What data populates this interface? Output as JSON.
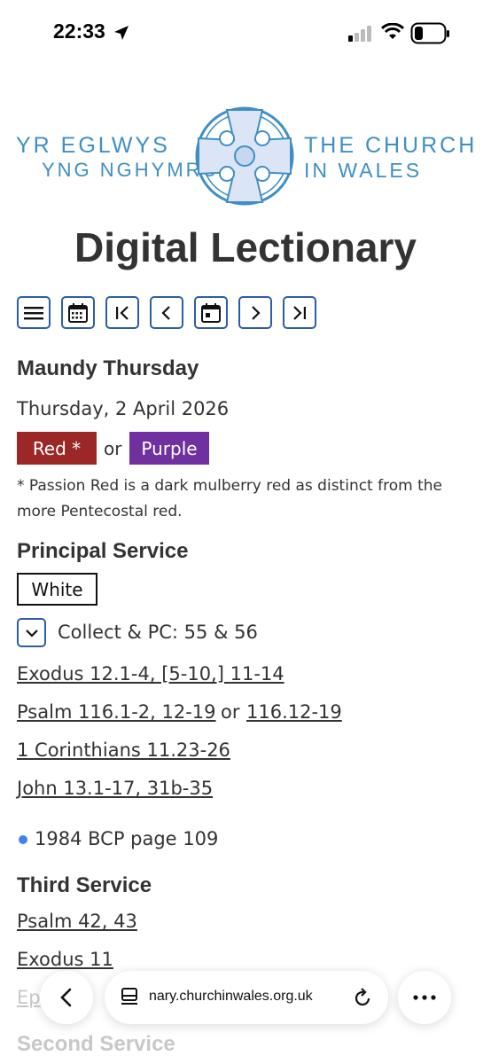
{
  "status": {
    "time": "22:33"
  },
  "logo": {
    "left_line1": "YR EGLWYS",
    "left_line2": "YNG NGHYMRU",
    "right_line1": "THE CHURCH",
    "right_line2": "IN WALES"
  },
  "page_title": "Digital Lectionary",
  "toolbar": [
    "menu-icon",
    "calendar-grid-icon",
    "first-icon",
    "prev-icon",
    "calendar-today-icon",
    "next-icon",
    "last-icon"
  ],
  "day": {
    "name": "Maundy Thursday",
    "date": "Thursday, 2 April 2026",
    "colour1": "Red *",
    "or": "or",
    "colour2": "Purple",
    "note": "* Passion Red is a dark mulberry red as distinct from the more Pentecostal red."
  },
  "principal": {
    "heading": "Principal Service",
    "colour": "White",
    "collect": "Collect & PC: 55 & 56",
    "readings": {
      "r1": "Exodus 12.1-4, [5-10,] 11-14",
      "psalm_a": "Psalm 116.1-2, 12-19",
      "psalm_or": "or",
      "psalm_b": "116.12-19",
      "r2": "1 Corinthians 11.23-26",
      "gospel": "John 13.1-17, 31b-35"
    },
    "bcp": "1984 BCP page 109"
  },
  "third": {
    "heading": "Third Service",
    "r1": "Psalm 42, 43",
    "r2": "Exodus 11",
    "r3": "Ep"
  },
  "second": {
    "heading": "Second Service"
  },
  "browser": {
    "url": "nary.churchinwales.org.uk"
  },
  "colors": {
    "red": "#9b2727",
    "purple": "#7030a0",
    "accent": "#2c5ea8",
    "logo": "#3f8fc4"
  }
}
